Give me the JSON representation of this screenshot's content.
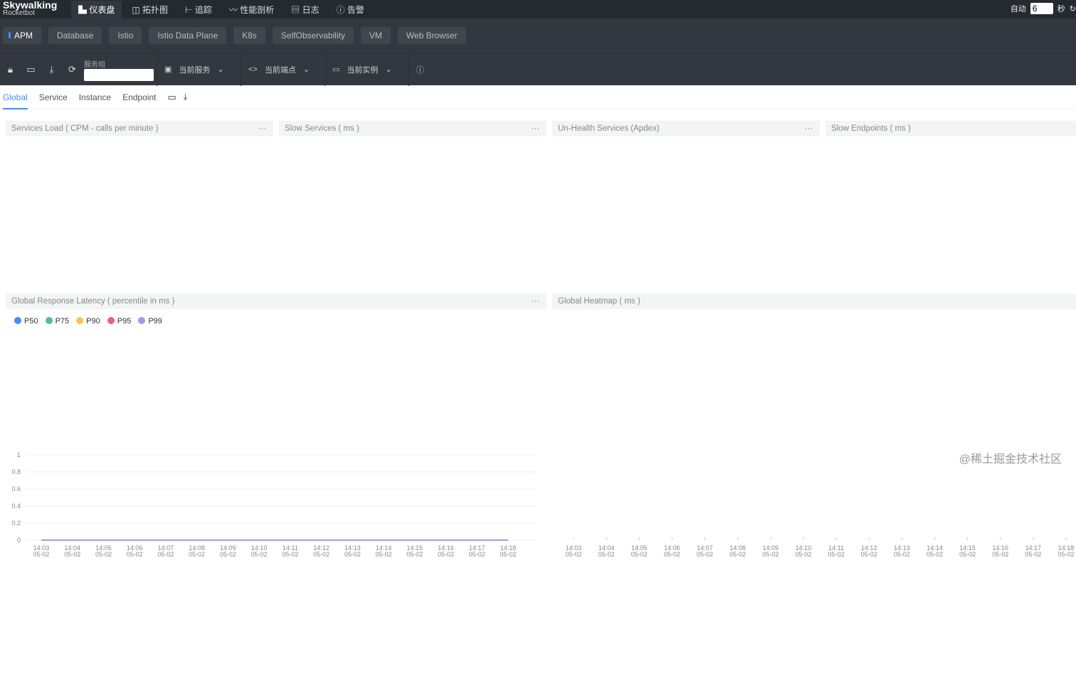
{
  "header": {
    "logo": "Skywalking",
    "logo_sub": "Rocketbot",
    "nav": [
      {
        "icon": "dashboard-icon",
        "glyph": "▙",
        "label": "仪表盘"
      },
      {
        "icon": "topology-icon",
        "glyph": "◫",
        "label": "拓扑图"
      },
      {
        "icon": "trace-icon",
        "glyph": "⊢",
        "label": "追踪"
      },
      {
        "icon": "profile-icon",
        "glyph": "〰",
        "label": "性能剖析"
      },
      {
        "icon": "log-icon",
        "glyph": "▤",
        "label": "日志"
      },
      {
        "icon": "alarm-icon",
        "glyph": "ⓘ",
        "label": "告警"
      }
    ],
    "auto_label": "自动",
    "interval": "6",
    "seconds_label": "秒"
  },
  "layers": [
    "APM",
    "Database",
    "Istio",
    "Istio Data Plane",
    "K8s",
    "SelfObservability",
    "VM",
    "Web Browser"
  ],
  "toolbar": {
    "group_label": "服务组",
    "group_value": "",
    "service": "当前服务",
    "endpoint": "当前端点",
    "instance": "当前实例"
  },
  "tabs": [
    "Global",
    "Service",
    "Instance",
    "Endpoint"
  ],
  "panels": {
    "p1": "Services Load ( CPM - calls per minute )",
    "p2": "Slow Services ( ms )",
    "p3": "Un-Health Services (Apdex)",
    "p4": "Slow Endpoints ( ms )",
    "p5": "Global Response Latency ( percentile in ms )",
    "p6": "Global Heatmap ( ms )",
    "menu": "···"
  },
  "colors": {
    "P50": "#448dfe",
    "P75": "#4bbfa7",
    "P90": "#ffc53d",
    "P95": "#f55a7a",
    "P99": "#9a9de8"
  },
  "chart_data": [
    {
      "type": "line",
      "title": "Global Response Latency ( percentile in ms )",
      "ylim": [
        0,
        1
      ],
      "yticks": [
        "0",
        "0.2",
        "0.4",
        "0.6",
        "0.8",
        "1"
      ],
      "categories": [
        "14:03\n05-02",
        "14:04\n05-02",
        "14:05\n05-02",
        "14:06\n05-02",
        "14:07\n05-02",
        "14:08\n05-02",
        "14:09\n05-02",
        "14:10\n05-02",
        "14:11\n05-02",
        "14:12\n05-02",
        "14:13\n05-02",
        "14:14\n05-02",
        "14:15\n05-02",
        "14:16\n05-02",
        "14:17\n05-02",
        "14:18\n05-02"
      ],
      "series": [
        {
          "name": "P50",
          "values": [
            0,
            0,
            0,
            0,
            0,
            0,
            0,
            0,
            0,
            0,
            0,
            0,
            0,
            0,
            0,
            0
          ]
        },
        {
          "name": "P75",
          "values": [
            0,
            0,
            0,
            0,
            0,
            0,
            0,
            0,
            0,
            0,
            0,
            0,
            0,
            0,
            0,
            0
          ]
        },
        {
          "name": "P90",
          "values": [
            0,
            0,
            0,
            0,
            0,
            0,
            0,
            0,
            0,
            0,
            0,
            0,
            0,
            0,
            0,
            0
          ]
        },
        {
          "name": "P95",
          "values": [
            0,
            0,
            0,
            0,
            0,
            0,
            0,
            0,
            0,
            0,
            0,
            0,
            0,
            0,
            0,
            0
          ]
        },
        {
          "name": "P99",
          "values": [
            0,
            0,
            0,
            0,
            0,
            0,
            0,
            0,
            0,
            0,
            0,
            0,
            0,
            0,
            0,
            0
          ]
        }
      ],
      "grid": true,
      "legend": "top-left"
    },
    {
      "type": "heatmap",
      "title": "Global Heatmap ( ms )",
      "categories": [
        "14:03\n05-02",
        "14:04\n05-02",
        "14:05\n05-02",
        "14:06\n05-02",
        "14:07\n05-02",
        "14:08\n05-02",
        "14:09\n05-02",
        "14:10\n05-02",
        "14:11\n05-02",
        "14:12\n05-02",
        "14:13\n05-02",
        "14:14\n05-02",
        "14:15\n05-02",
        "14:16\n05-02",
        "14:17\n05-02",
        "14:18\n05-02"
      ]
    }
  ],
  "watermark": "@稀土掘金技术社区"
}
